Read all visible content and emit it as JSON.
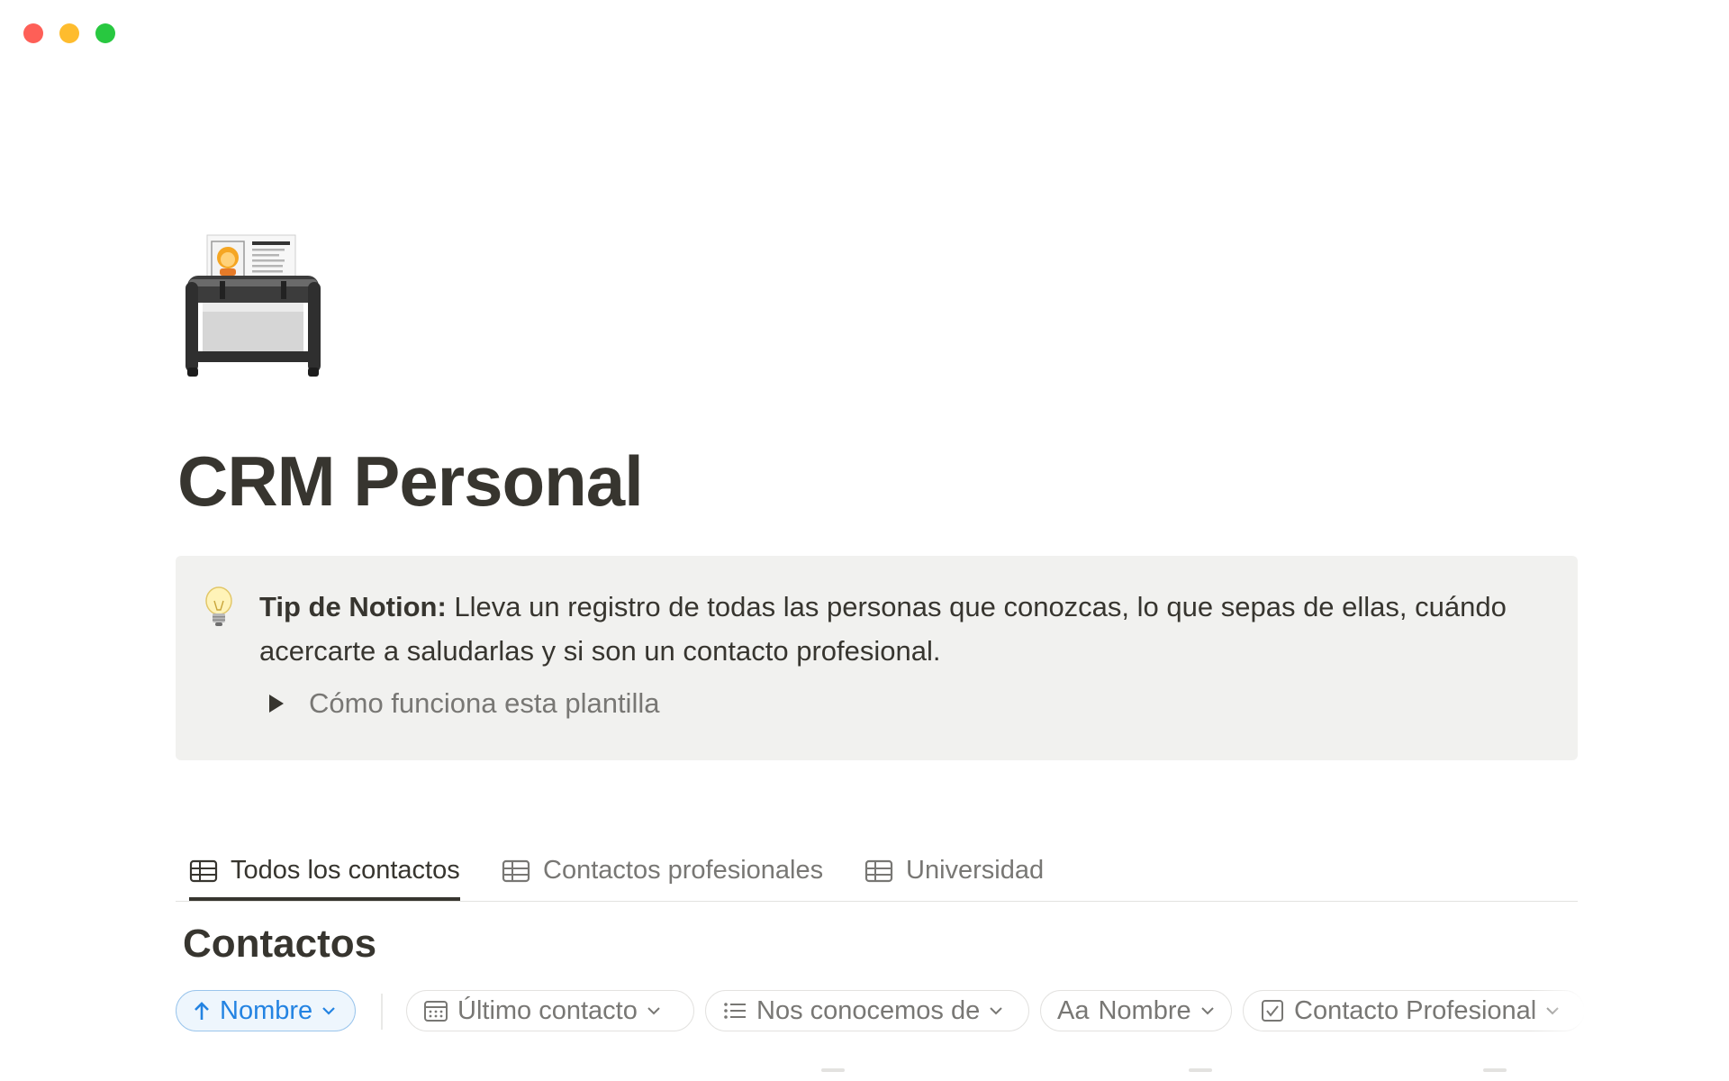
{
  "window": {
    "controls": [
      "close",
      "minimize",
      "zoom"
    ]
  },
  "page": {
    "icon": "rolodex-icon",
    "title": "CRM Personal"
  },
  "callout": {
    "icon": "lightbulb-icon",
    "bold": "Tip de Notion:",
    "text": " Lleva un registro de todas las personas que conozcas, lo que sepas de ellas, cuándo acercarte a saludarlas y si son un contacto profesional.",
    "toggle_label": "Cómo funciona esta plantilla"
  },
  "views": {
    "tabs": [
      {
        "label": "Todos los contactos",
        "icon": "table-icon",
        "active": true
      },
      {
        "label": "Contactos profesionales",
        "icon": "table-icon",
        "active": false
      },
      {
        "label": "Universidad",
        "icon": "table-icon",
        "active": false
      }
    ]
  },
  "database": {
    "title": "Contactos",
    "sort_chip": {
      "label": "Nombre",
      "icon": "arrow-up-icon"
    },
    "filters": [
      {
        "label": "Último contacto",
        "icon": "calendar-icon"
      },
      {
        "label": "Nos conocemos de",
        "icon": "list-icon"
      },
      {
        "label": "Nombre",
        "icon": "text-aa-icon",
        "prefix": "Aa"
      },
      {
        "label": "Contacto Profesional",
        "icon": "checkbox-icon"
      }
    ]
  },
  "colors": {
    "text": "#37352f",
    "muted": "#787774",
    "callout_bg": "#f1f1ef",
    "accent_blue": "#2383e2",
    "traffic_red": "#fe5f57",
    "traffic_yellow": "#febc2e",
    "traffic_green": "#28c840"
  }
}
